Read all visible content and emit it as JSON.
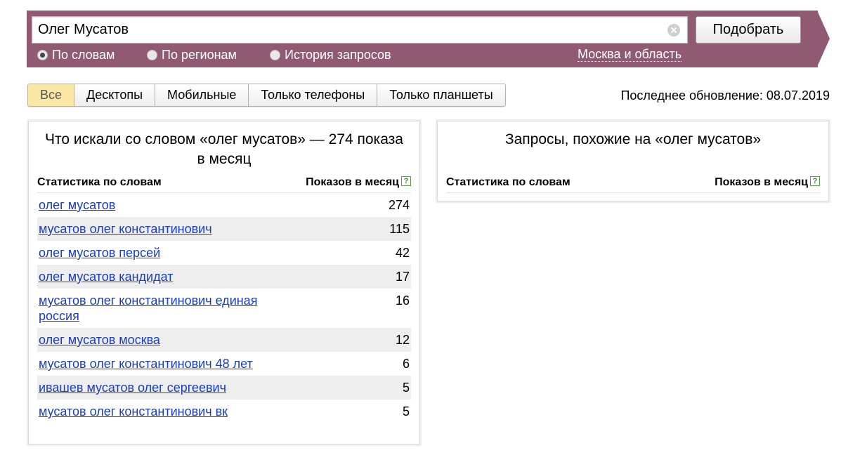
{
  "search": {
    "query": "Олег Мусатов",
    "submit_label": "Подобрать",
    "modes": [
      {
        "label": "По словам",
        "checked": true
      },
      {
        "label": "По регионам",
        "checked": false
      },
      {
        "label": "История запросов",
        "checked": false
      }
    ],
    "region": "Москва и область",
    "band_color": "#8f5a72"
  },
  "device_tabs": [
    "Все",
    "Десктопы",
    "Мобильные",
    "Только телефоны",
    "Только планшеты"
  ],
  "last_update": "Последнее обновление: 08.07.2019",
  "left_panel": {
    "title": "Что искали со словом «олег мусатов» — 274 показа в месяц",
    "col_words": "Статистика по словам",
    "col_shows": "Показов в месяц",
    "rows": [
      {
        "phrase": "олег мусатов",
        "count": "274"
      },
      {
        "phrase": "мусатов олег константинович",
        "count": "115"
      },
      {
        "phrase": "олег мусатов персей",
        "count": "42"
      },
      {
        "phrase": "олег мусатов кандидат",
        "count": "17"
      },
      {
        "phrase": "мусатов олег константинович единая россия",
        "count": "16"
      },
      {
        "phrase": "олег мусатов москва",
        "count": "12"
      },
      {
        "phrase": "мусатов олег константинович 48 лет",
        "count": "6"
      },
      {
        "phrase": "ивашев мусатов олег сергеевич",
        "count": "5"
      },
      {
        "phrase": "мусатов олег константинович вк",
        "count": "5"
      }
    ]
  },
  "right_panel": {
    "title": "Запросы, похожие на «олег мусатов»",
    "col_words": "Статистика по словам",
    "col_shows": "Показов в месяц"
  },
  "icons": {
    "clear": "clear-icon",
    "help": "help-icon"
  }
}
